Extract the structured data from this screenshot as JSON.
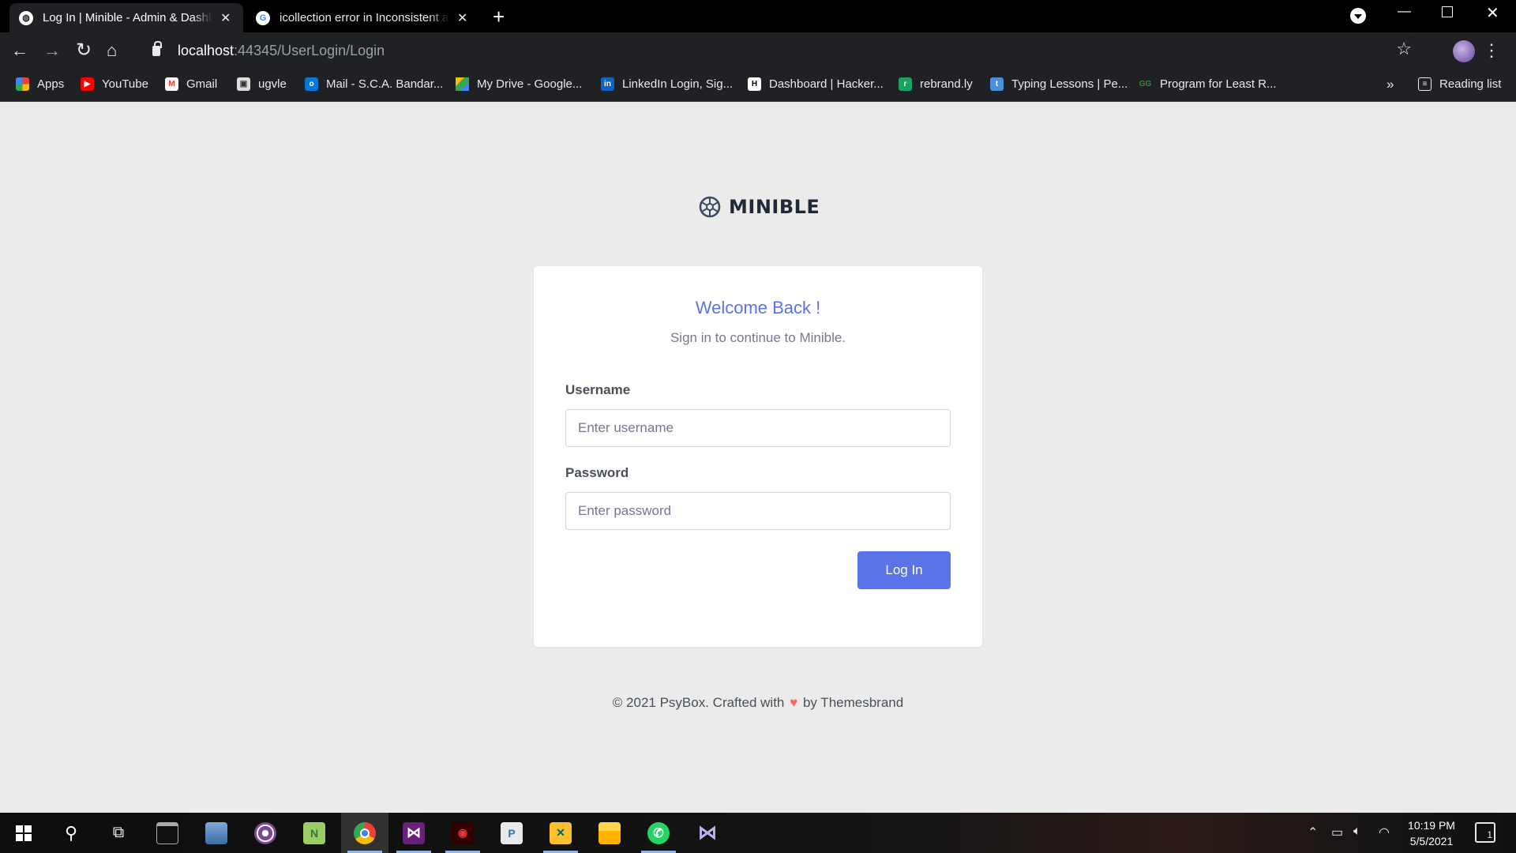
{
  "browser": {
    "tabs": [
      {
        "title": "Log In | Minible - Admin & Dashboard Template",
        "active": true
      },
      {
        "title": "icollection error in Inconsistent accessibility",
        "active": false
      }
    ],
    "url_host": "localhost",
    "url_rest": ":44345/UserLogin/Login",
    "bookmarks": [
      {
        "label": "Apps",
        "icon": "apps-grid-icon"
      },
      {
        "label": "YouTube",
        "icon": "youtube-icon"
      },
      {
        "label": "Gmail",
        "icon": "gmail-icon"
      },
      {
        "label": "ugvle",
        "icon": "ugvle-icon"
      },
      {
        "label": "Mail - S.C.A. Bandar...",
        "icon": "outlook-icon"
      },
      {
        "label": "My Drive - Google...",
        "icon": "google-drive-icon"
      },
      {
        "label": "LinkedIn Login, Sig...",
        "icon": "linkedin-icon"
      },
      {
        "label": "Dashboard | Hacker...",
        "icon": "hackerrank-icon"
      },
      {
        "label": "rebrand.ly",
        "icon": "rebrandly-icon"
      },
      {
        "label": "Typing Lessons | Pe...",
        "icon": "typing-icon"
      },
      {
        "label": "Program for Least R...",
        "icon": "geeksforgeeks-icon"
      }
    ],
    "more_bookmarks": "»",
    "reading_list": "Reading list"
  },
  "page": {
    "brand": "MINIBLE",
    "welcome": "Welcome Back !",
    "subtitle": "Sign in to continue to Minible.",
    "username_label": "Username",
    "username_placeholder": "Enter username",
    "password_label": "Password",
    "password_placeholder": "Enter password",
    "login_button": "Log In",
    "footer_prefix": "© 2021 PsyBox. Crafted with",
    "footer_suffix": "by Themesbrand"
  },
  "taskbar": {
    "time": "10:19 PM",
    "date": "5/5/2021",
    "notification_count": "1"
  },
  "colors": {
    "accent": "#5b73e8",
    "page_bg": "#ebebeb",
    "card_bg": "#ffffff",
    "heart": "#f46a6a"
  }
}
